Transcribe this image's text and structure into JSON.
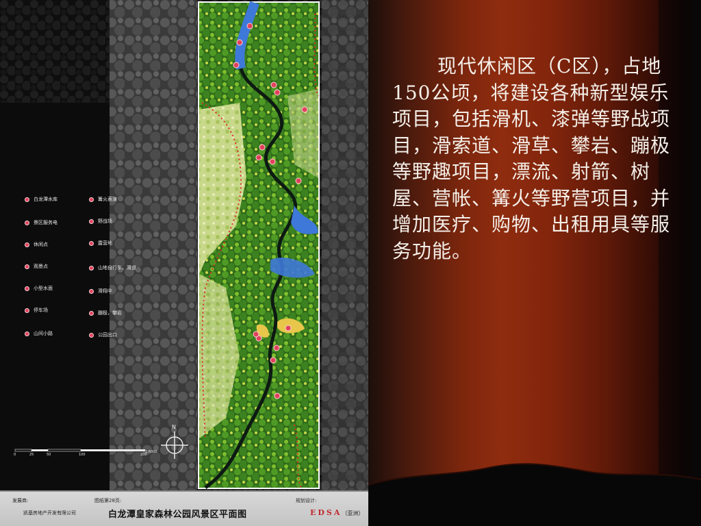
{
  "map": {
    "legend_left": [
      "白龙潭水库",
      "景区服务电",
      "休闲点",
      "观景点",
      "小型水面",
      "停车场",
      "山间小路"
    ],
    "legend_right": [
      "篝火表演",
      "野战场",
      "露营地",
      "山地自行车，滑道",
      "滑翔伞",
      "蹦极，攀岩",
      "公园出口"
    ],
    "scale_labels": [
      "0",
      "25",
      "50",
      "100",
      "200"
    ],
    "scale_unit": "1:6000",
    "north_label": "N"
  },
  "title_block": {
    "developer_label": "发展商:",
    "developer_name": "凯基房地产开发有限公司",
    "sheet_label": "图纸第28页:",
    "drawing_title": "白龙潭皇家森林公园风景区平面图",
    "designer_label": "规划设计:",
    "designer_name": "EDSA",
    "designer_suffix": "（亚洲）"
  },
  "slide": {
    "body_text": "现代休闲区（C区），占地150公顷，将建设各种新型娱乐项目，包括滑机、漆弹等野战项目，滑索道、滑草、攀岩、蹦极等野趣项目，漂流、射箭、树屋、营帐、篝火等野营项目，并增加医疗、购物、出租用具等服务功能。"
  },
  "colors": {
    "marker": "#e0415a",
    "slide_red": "#8f2c0f",
    "text": "#f4efe8",
    "edsa": "#c0272d"
  }
}
